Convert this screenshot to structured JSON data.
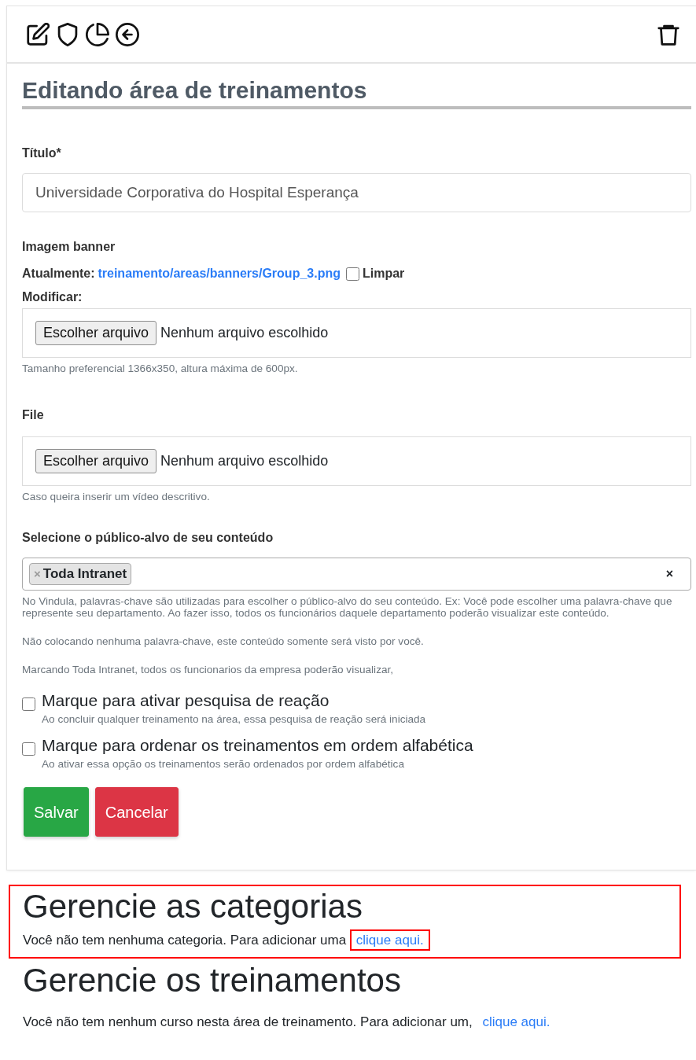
{
  "page_title": "Editando área de treinamentos",
  "title_field": {
    "label": "Título*",
    "value": "Universidade Corporativa do Hospital Esperança"
  },
  "banner": {
    "label": "Imagem banner",
    "current_label": "Atualmente:",
    "current_link": "treinamento/areas/banners/Group_3.png",
    "clear_checked": false,
    "clear_label": "Limpar",
    "modify_label": "Modificar:",
    "button": "Escolher arquivo",
    "status": "Nenhum arquivo escolhido",
    "help": "Tamanho preferencial 1366x350, altura máxima de 600px."
  },
  "file": {
    "label": "File",
    "button": "Escolher arquivo",
    "status": "Nenhum arquivo escolhido",
    "help": "Caso queira inserir um vídeo descritivo."
  },
  "audience": {
    "label": "Selecione o público-alvo de seu conteúdo",
    "tags": [
      {
        "remove": "×",
        "label": "Toda Intranet"
      }
    ],
    "clear": "×",
    "help": [
      "No Vindula, palavras-chave são utilizadas para escolher o público-alvo do seu conteúdo. Ex: Você pode escolher uma palavra-chave que represente seu departamento. Ao fazer isso, todos os funcionários daquele departamento poderão visualizar este conteúdo.",
      "Não colocando nenhuma palavra-chave, este conteúdo somente será visto por você.",
      "Marcando Toda Intranet, todos os funcionarios da empresa poderão visualizar,"
    ]
  },
  "options": [
    {
      "label": "Marque para ativar pesquisa de reação",
      "help": "Ao concluir qualquer treinamento na área, essa pesquisa de reação será iniciada",
      "checked": false
    },
    {
      "label": "Marque para ordenar os treinamentos em ordem alfabética",
      "help": "Ao ativar essa opção os treinamentos serão ordenados por ordem alfabética",
      "checked": false
    }
  ],
  "buttons": [
    {
      "label": "Salvar",
      "kind": "save"
    },
    {
      "label": "Cancelar",
      "kind": "cancel"
    }
  ],
  "sections": [
    {
      "title": "Gerencie as categorias",
      "text": "Você não tem nenhuma categoria. Para adicionar uma",
      "link": "clique aqui.",
      "highlighted": true,
      "link_highlighted": true
    },
    {
      "title": "Gerencie os treinamentos",
      "text": "Você não tem nenhum curso nesta área de treinamento. Para adicionar um,",
      "link": "clique aqui.",
      "highlighted": false,
      "link_highlighted": false
    }
  ]
}
